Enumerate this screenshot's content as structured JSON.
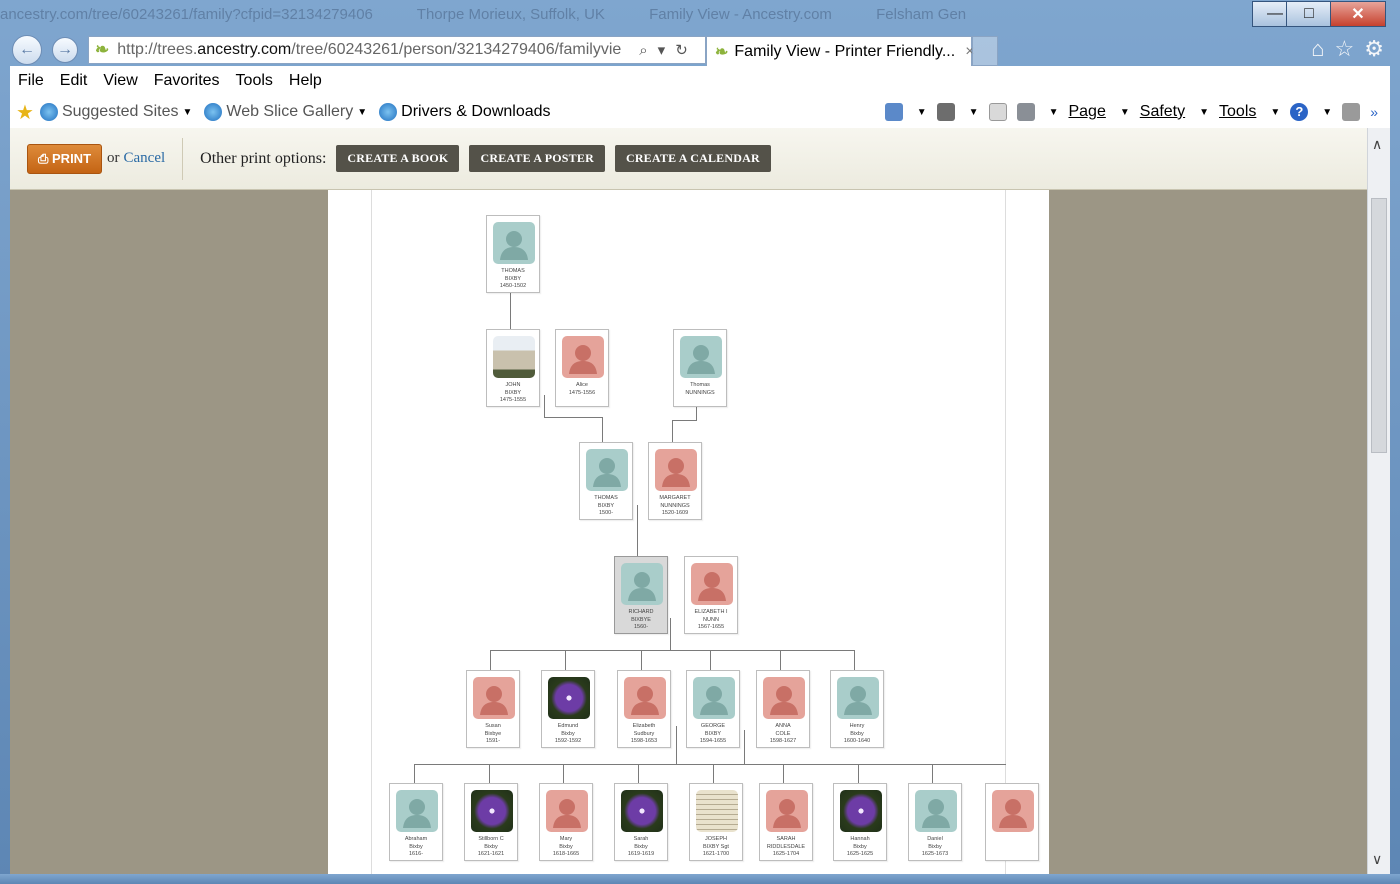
{
  "window": {
    "ghost_tabs": [
      "ancestry.com/tree/60243261/family?cfpid=32134279406",
      "Thorpe Morieux, Suffolk, UK",
      "Family View - Ancestry.com",
      "Felsham Gen"
    ],
    "controls": {
      "minimize": "—",
      "maximize": "□",
      "close": "✕"
    }
  },
  "nav": {
    "back_icon": "←",
    "forward_icon": "→",
    "url_prefix": "http://trees.",
    "url_domain": "ancestry.com",
    "url_rest": "/tree/60243261/person/32134279406/familyvie",
    "active_tab_title": "Family View - Printer Friendly...",
    "tab_close": "×"
  },
  "menu": [
    "File",
    "Edit",
    "View",
    "Favorites",
    "Tools",
    "Help"
  ],
  "favorites": [
    {
      "label": "Suggested Sites",
      "dimmed": true
    },
    {
      "label": "Web Slice Gallery",
      "dimmed": true
    },
    {
      "label": "Drivers & Downloads",
      "dimmed": false
    }
  ],
  "command_bar": {
    "page": "Page",
    "safety": "Safety",
    "tools": "Tools",
    "help": "?"
  },
  "print_bar": {
    "print_label": "PRINT",
    "or_text": "or",
    "cancel_label": "Cancel",
    "other_label": "Other print options:",
    "options": [
      "CREATE A BOOK",
      "CREATE A POSTER",
      "CREATE A CALENDAR"
    ]
  },
  "tree": {
    "people": [
      {
        "name1": "THOMAS",
        "name2": "BIXBY",
        "dates": "1450-1502",
        "gender": "male",
        "photo": "silhouette"
      },
      {
        "name1": "JOHN",
        "name2": "BIXBY",
        "dates": "1475-1555",
        "gender": "male",
        "photo": "church"
      },
      {
        "name1": "Alice",
        "name2": "",
        "dates": "1475-1556",
        "gender": "female",
        "photo": "silhouette"
      },
      {
        "name1": "Thomas",
        "name2": "NUNNINGS",
        "dates": "",
        "gender": "male",
        "photo": "silhouette"
      },
      {
        "name1": "THOMAS",
        "name2": "BIXBY",
        "dates": "1500-",
        "gender": "male",
        "photo": "silhouette"
      },
      {
        "name1": "MARGARET",
        "name2": "NUNNINGS",
        "dates": "1520-1609",
        "gender": "female",
        "photo": "silhouette"
      },
      {
        "name1": "RICHARD",
        "name2": "BIXBYE",
        "dates": "1560-",
        "gender": "male",
        "photo": "silhouette",
        "selected": true
      },
      {
        "name1": "ELIZABETH I",
        "name2": "NUNN",
        "dates": "1567-1655",
        "gender": "female",
        "photo": "silhouette"
      },
      {
        "name1": "Susan",
        "name2": "Bixbye",
        "dates": "1591-",
        "gender": "female",
        "photo": "silhouette"
      },
      {
        "name1": "Edmund",
        "name2": "Bixby",
        "dates": "1592-1592",
        "gender": "male",
        "photo": "flower"
      },
      {
        "name1": "Elizabeth",
        "name2": "Sudbury",
        "dates": "1598-1653",
        "gender": "female",
        "photo": "silhouette"
      },
      {
        "name1": "GEORGE",
        "name2": "BIXBY",
        "dates": "1594-1655",
        "gender": "male",
        "photo": "silhouette"
      },
      {
        "name1": "ANNA",
        "name2": "COLE",
        "dates": "1598-1627",
        "gender": "female",
        "photo": "silhouette"
      },
      {
        "name1": "Henry",
        "name2": "Bixby",
        "dates": "1600-1640",
        "gender": "male",
        "photo": "silhouette"
      },
      {
        "name1": "Abraham",
        "name2": "Bixby",
        "dates": "1616-",
        "gender": "male",
        "photo": "silhouette"
      },
      {
        "name1": "Stillborn C",
        "name2": "Bixby",
        "dates": "1621-1621",
        "gender": "male",
        "photo": "flower"
      },
      {
        "name1": "Mary",
        "name2": "Bixby",
        "dates": "1618-1665",
        "gender": "female",
        "photo": "silhouette"
      },
      {
        "name1": "Sarah",
        "name2": "Bixby",
        "dates": "1619-1619",
        "gender": "female",
        "photo": "flower"
      },
      {
        "name1": "JOSEPH",
        "name2": "BIXBY Sgt",
        "dates": "1621-1700",
        "gender": "male",
        "photo": "document"
      },
      {
        "name1": "SARAH",
        "name2": "RIDDLESDALE",
        "dates": "1625-1704",
        "gender": "female",
        "photo": "silhouette"
      },
      {
        "name1": "Hannah",
        "name2": "Bixby",
        "dates": "1625-1625",
        "gender": "female",
        "photo": "flower"
      },
      {
        "name1": "Daniel",
        "name2": "Bixby",
        "dates": "1625-1673",
        "gender": "male",
        "photo": "silhouette"
      },
      {
        "name1": "",
        "name2": "",
        "dates": "",
        "gender": "female",
        "photo": "silhouette"
      }
    ]
  }
}
